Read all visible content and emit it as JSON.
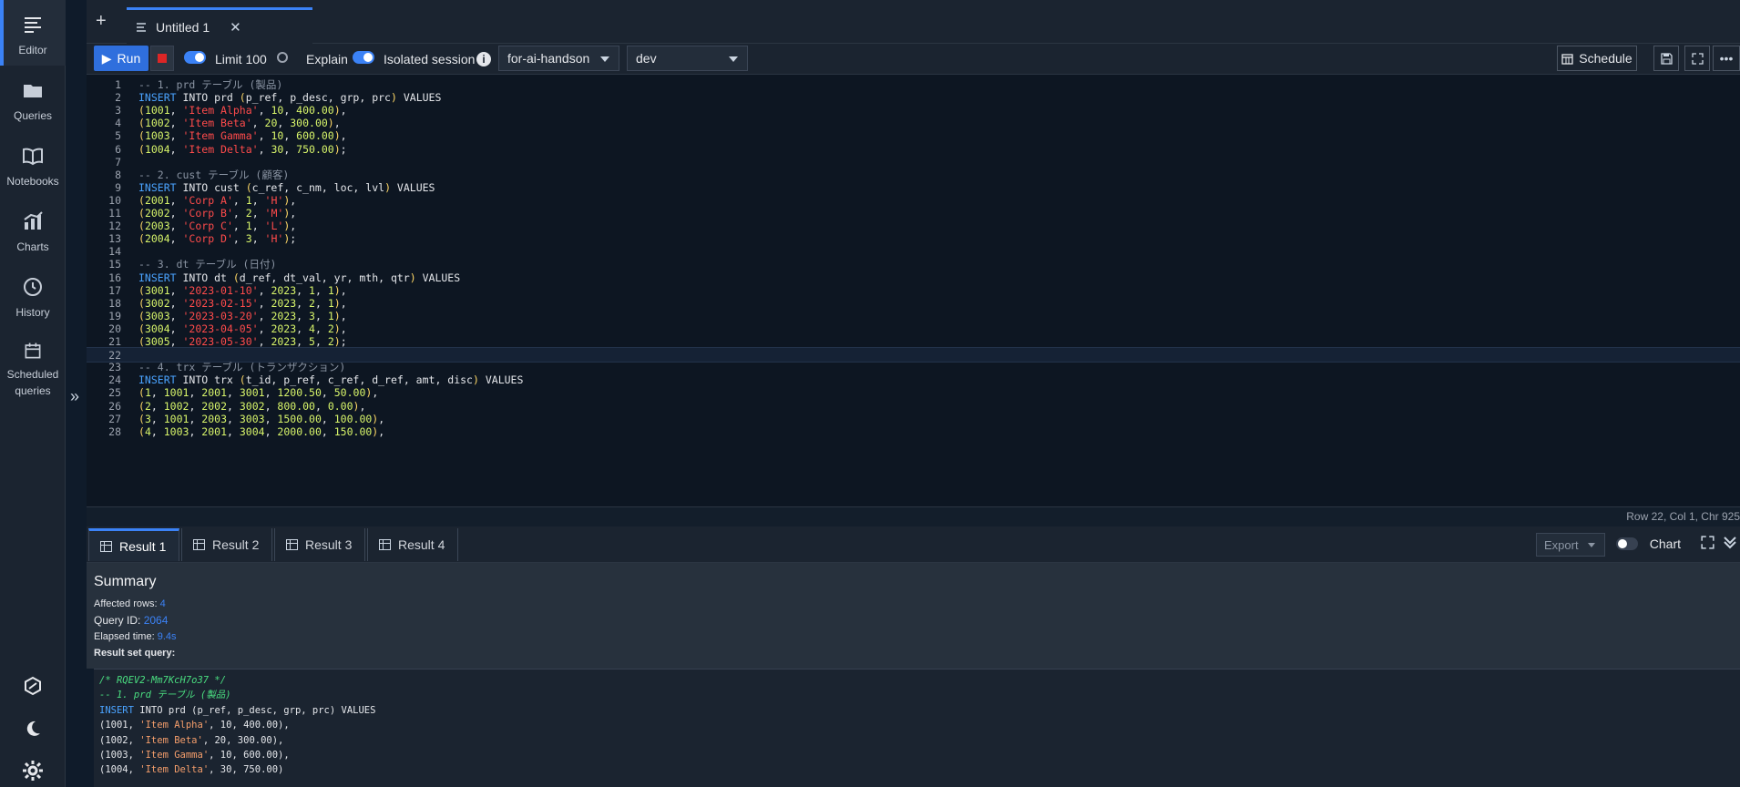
{
  "rail": {
    "items": [
      {
        "label": "Editor",
        "icon": "editor-icon"
      },
      {
        "label": "Queries",
        "icon": "folder-icon"
      },
      {
        "label": "Notebooks",
        "icon": "book-icon"
      },
      {
        "label": "Charts",
        "icon": "chart-icon"
      },
      {
        "label": "History",
        "icon": "clock-icon"
      },
      {
        "label": "Scheduled queries",
        "icon": "calendar-icon"
      }
    ]
  },
  "editor_tab": {
    "title": "Untitled 1"
  },
  "toolbar": {
    "run_label": "Run",
    "limit_label": "Limit 100",
    "explain_label": "Explain",
    "isolated_label": "Isolated session",
    "connection": "for-ai-handson",
    "database": "dev",
    "schedule_label": "Schedule"
  },
  "code_lines": [
    "-- 1. prd テーブル (製品)",
    "INSERT INTO prd (p_ref, p_desc, grp, prc) VALUES",
    "(1001, 'Item Alpha', 10, 400.00),",
    "(1002, 'Item Beta', 20, 300.00),",
    "(1003, 'Item Gamma', 10, 600.00),",
    "(1004, 'Item Delta', 30, 750.00);",
    "",
    "-- 2. cust テーブル (顧客)",
    "INSERT INTO cust (c_ref, c_nm, loc, lvl) VALUES",
    "(2001, 'Corp A', 1, 'H'),",
    "(2002, 'Corp B', 2, 'M'),",
    "(2003, 'Corp C', 1, 'L'),",
    "(2004, 'Corp D', 3, 'H');",
    "",
    "-- 3. dt テーブル (日付)",
    "INSERT INTO dt (d_ref, dt_val, yr, mth, qtr) VALUES",
    "(3001, '2023-01-10', 2023, 1, 1),",
    "(3002, '2023-02-15', 2023, 2, 1),",
    "(3003, '2023-03-20', 2023, 3, 1),",
    "(3004, '2023-04-05', 2023, 4, 2),",
    "(3005, '2023-05-30', 2023, 5, 2);",
    "",
    "-- 4. trx テーブル (トランザクション)",
    "INSERT INTO trx (t_id, p_ref, c_ref, d_ref, amt, disc) VALUES",
    "(1, 1001, 2001, 3001, 1200.50, 50.00),",
    "(2, 1002, 2002, 3002, 800.00, 0.00),",
    "(3, 1001, 2003, 3003, 1500.00, 100.00),",
    "(4, 1003, 2001, 3004, 2000.00, 150.00),"
  ],
  "status_bar": {
    "cursor": "Row 22,  Col 1,  Chr 925"
  },
  "results": {
    "tabs": [
      "Result 1",
      "Result 2",
      "Result 3",
      "Result 4"
    ],
    "export_label": "Export",
    "chart_label": "Chart"
  },
  "summary": {
    "title": "Summary",
    "affected_rows_label": "Affected rows:",
    "affected_rows": "4",
    "query_id_label": "Query ID:",
    "query_id": "2064",
    "elapsed_label": "Elapsed time:",
    "elapsed": "9.4s",
    "result_set_label": "Result set query:"
  },
  "result_query_lines": [
    "/* RQEV2-Mm7KcH7o37 */",
    "-- 1. prd テーブル (製品)",
    "INSERT INTO prd (p_ref, p_desc, grp, prc) VALUES",
    "(1001, 'Item Alpha', 10, 400.00),",
    "(1002, 'Item Beta', 20, 300.00),",
    "(1003, 'Item Gamma', 10, 600.00),",
    "(1004, 'Item Delta', 30, 750.00)"
  ],
  "colors": {
    "accent": "#3b82f6",
    "stop": "#dc2626",
    "keyword": "#4aa3ff",
    "string": "#ff4b4b",
    "number": "#d8f56a"
  }
}
